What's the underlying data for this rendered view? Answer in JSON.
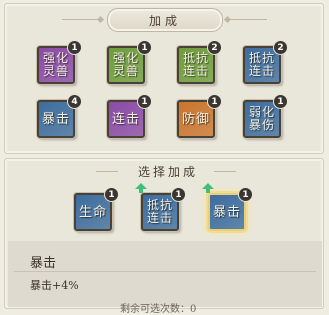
{
  "header": {
    "title": "加成"
  },
  "owned_bonuses": [
    {
      "label": "强化\n灵兽",
      "count": "1",
      "color": "#8a4aa6"
    },
    {
      "label": "强化\n灵兽",
      "count": "1",
      "color": "#6e9c3c"
    },
    {
      "label": "抵抗\n连击",
      "count": "2",
      "color": "#6e9c3c"
    },
    {
      "label": "抵抗\n连击",
      "count": "2",
      "color": "#3d6d9e"
    },
    {
      "label": "暴击",
      "count": "4",
      "color": "#3d6d9e"
    },
    {
      "label": "连击",
      "count": "1",
      "color": "#8a4aa6"
    },
    {
      "label": "防御",
      "count": "1",
      "color": "#c9752e"
    },
    {
      "label": "弱化\n暴伤",
      "count": "1",
      "color": "#3d6d9e"
    }
  ],
  "select": {
    "title": "选择加成",
    "options": [
      {
        "label": "生命",
        "count": "1",
        "upgrade": false,
        "color": "#3d6d9e"
      },
      {
        "label": "抵抗\n连击",
        "count": "1",
        "upgrade": true,
        "color": "#3d6d9e"
      },
      {
        "label": "暴击",
        "count": "1",
        "upgrade": true,
        "color": "#3d6d9e",
        "selected": true
      }
    ]
  },
  "detail": {
    "name": "暴击",
    "effect": "暴击+4%"
  },
  "footer": {
    "text": "剩余可选次数：0"
  },
  "colors": {
    "badge": "#3b3631",
    "upgrade_arrow": "#3fbf7a",
    "selected_border": "#e9cf7a"
  }
}
